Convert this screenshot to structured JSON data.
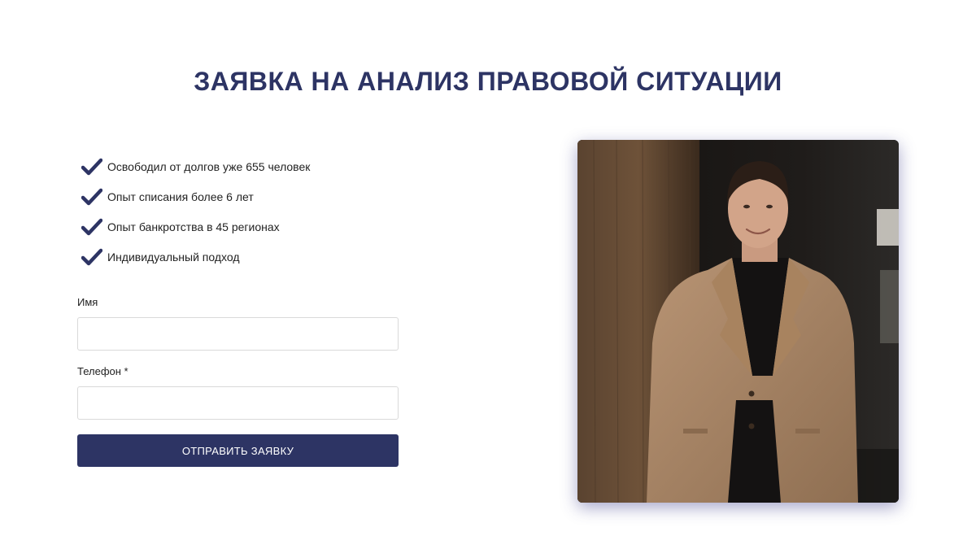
{
  "page": {
    "title": "ЗАЯВКА НА АНАЛИЗ ПРАВОВОЙ СИТУАЦИИ"
  },
  "benefits": [
    {
      "icon": "checkmark-icon",
      "text": "Освободил от долгов уже 655 человек"
    },
    {
      "icon": "checkmark-icon",
      "text": "Опыт списания более 6 лет"
    },
    {
      "icon": "checkmark-icon",
      "text": "Опыт банкротства в 45 регионах"
    },
    {
      "icon": "checkmark-icon",
      "text": "Индивидуальный подход"
    }
  ],
  "form": {
    "name_label": "Имя",
    "name_value": "",
    "phone_label": "Телефон *",
    "phone_value": "",
    "submit_label": "ОТПРАВИТЬ ЗАЯВКУ"
  },
  "colors": {
    "accent": "#2d3464",
    "text": "#222222",
    "border": "#d9d9d9"
  }
}
